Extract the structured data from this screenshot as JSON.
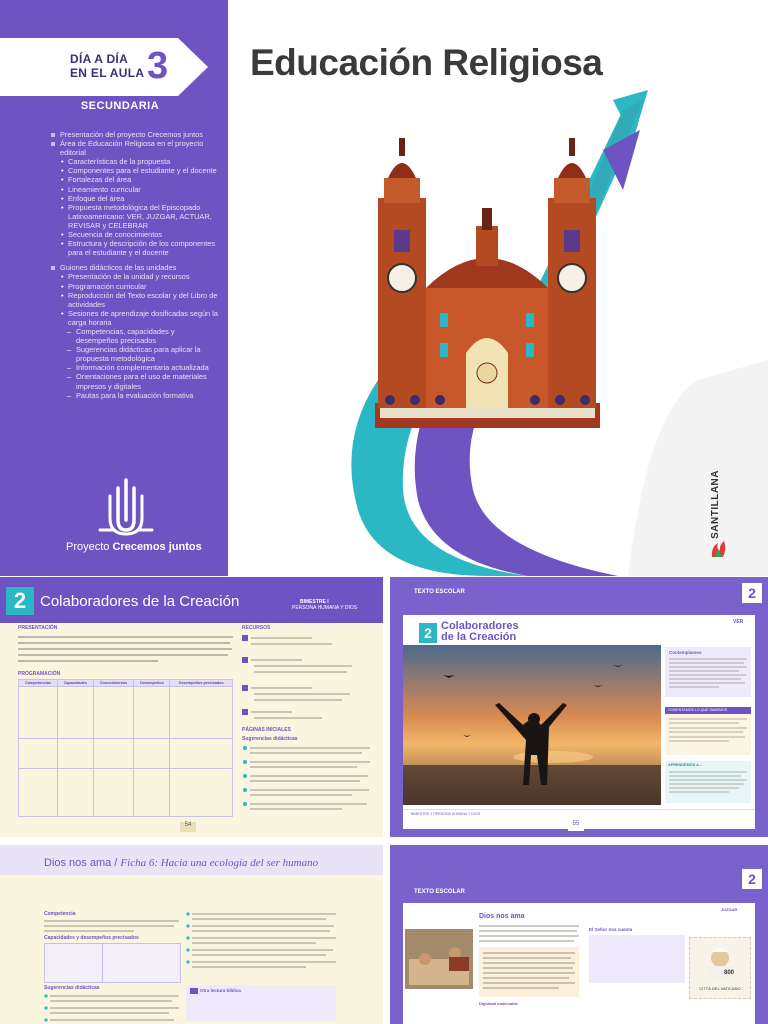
{
  "cover": {
    "badge": {
      "line1": "DÍA A DÍA",
      "line2": "EN EL AULA",
      "number": "3"
    },
    "level": "SECUNDARIA",
    "title": "Educación Religiosa",
    "toc": [
      {
        "kind": "sq",
        "text": "Presentación del proyecto Crecemos juntos"
      },
      {
        "kind": "sq",
        "text": "Área de Educación Religiosa en el proyecto editorial"
      },
      {
        "kind": "sub",
        "text": "Características de la propuesta"
      },
      {
        "kind": "sub",
        "text": "Componentes para el estudiante y el docente"
      },
      {
        "kind": "sub",
        "text": "Fortalezas del área"
      },
      {
        "kind": "sub",
        "text": "Lineamiento curricular"
      },
      {
        "kind": "sub",
        "text": "Enfoque del área"
      },
      {
        "kind": "sub",
        "text": "Propuesta metodológica del Episcopado Latinoamericano: VER, JUZGAR, ACTUAR, REVISAR y CELEBRAR"
      },
      {
        "kind": "sub",
        "text": "Secuencia de conocimientos"
      },
      {
        "kind": "sub",
        "text": "Estructura y descripción de los componentes para el estudiante y el docente"
      },
      {
        "kind": "gap",
        "text": ""
      },
      {
        "kind": "sq",
        "text": "Guiones didácticos de las unidades"
      },
      {
        "kind": "sub",
        "text": "Presentación de la unidad y recursos"
      },
      {
        "kind": "sub",
        "text": "Programación curricular"
      },
      {
        "kind": "sub",
        "text": "Reproducción del Texto escolar y del Libro de actividades"
      },
      {
        "kind": "sub",
        "text": "Sesiones de aprendizaje dosificadas según la carga horaria"
      },
      {
        "kind": "sub2",
        "text": "Competencias, capacidades y desempeños precisados"
      },
      {
        "kind": "sub2",
        "text": "Sugerencias didácticas para aplicar la propuesta metodológica"
      },
      {
        "kind": "sub2",
        "text": "Información complementaria actualizada"
      },
      {
        "kind": "sub2",
        "text": "Orientaciones para el uso de materiales impresos y digitales"
      },
      {
        "kind": "sub2",
        "text": "Pautas para la evaluación formativa"
      }
    ],
    "project_prefix": "Proyecto",
    "project_name": "Crecemos juntos",
    "publisher": "SANTILLANA"
  },
  "spread1": {
    "unit_number": "2",
    "unit_title": "Colaboradores de la Creación",
    "bimester": "BIMESTRE I",
    "bimester_sub": "PERSONA HUMANA Y DIOS",
    "presentacion_label": "PRESENTACIÓN",
    "recursos_label": "RECURSOS",
    "programacion_label": "PROGRAMACIÓN",
    "table_headers": [
      "Competencias",
      "Capacidades",
      "Conocimientos",
      "Desempeños",
      "Desempeños precisados"
    ],
    "sugerencias_label": "Sugerencias didácticas",
    "paginas_label": "PÁGINAS INICIALES",
    "page_left": "54",
    "page_right": "55",
    "texto_escolar": "TEXTO ESCOLAR",
    "tab_number": "2",
    "book_unit_number": "2",
    "book_title_line1": "Colaboradores",
    "book_title_line2": "de la Creación",
    "ver_tag": "VER",
    "contemplamos": "Contemplamos",
    "comentamos": "COMENTAMOS LO QUE SABEMOS",
    "aprendamos": "APRENDEMOS A...",
    "footer_bimestre": "BIMESTRE 1 PERSONA HUMANA Y DIOS"
  },
  "spread2": {
    "title_prefix": "Dios nos ama / ",
    "title_ficha": "Ficha 6: Hacia una ecología del ser humano",
    "competencia_label": "Competencia",
    "capacidades_label": "Capacidades y desempeños precisados",
    "sugerencias_label": "Sugerencias didácticas",
    "otra_label": "Otra lectura bíblica",
    "texto_escolar": "TEXTO ESCOLAR",
    "tab_number": "2",
    "book_section": "Dios nos ama",
    "juzgar_tag": "JUZGAR",
    "sidebar_title": "El Señor nos cuenta",
    "dignidad": "Dignidad inalienable",
    "stamp_value": "800",
    "stamp_text": "CITTÀ DEL VATICANO"
  },
  "colors": {
    "purple": "#6e54c2",
    "teal": "#2bb7c3",
    "cream": "#faf5df"
  }
}
